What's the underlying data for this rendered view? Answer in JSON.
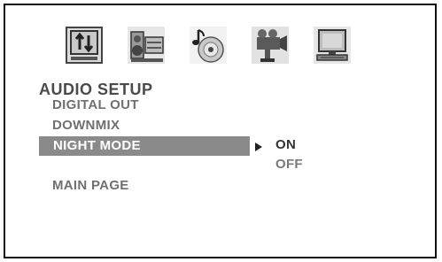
{
  "icons": [
    {
      "name": "general-setup-icon",
      "highlighted": false
    },
    {
      "name": "speaker-setup-icon",
      "highlighted": false
    },
    {
      "name": "audio-setup-icon",
      "highlighted": true
    },
    {
      "name": "video-setup-icon",
      "highlighted": false
    },
    {
      "name": "preference-setup-icon",
      "highlighted": false
    }
  ],
  "menu": {
    "title": "AUDIO SETUP",
    "items": [
      {
        "label": "DIGITAL OUT",
        "selected": false
      },
      {
        "label": "DOWNMIX",
        "selected": false
      },
      {
        "label": "NIGHT MODE",
        "selected": true
      }
    ],
    "main_page": "MAIN PAGE"
  },
  "submenu": {
    "options": [
      {
        "label": "ON",
        "active": true
      },
      {
        "label": "OFF",
        "active": false
      }
    ]
  },
  "colors": {
    "highlight_bar": "#8a8a8a",
    "title_text": "#4a4a4a",
    "item_text": "#707070"
  }
}
